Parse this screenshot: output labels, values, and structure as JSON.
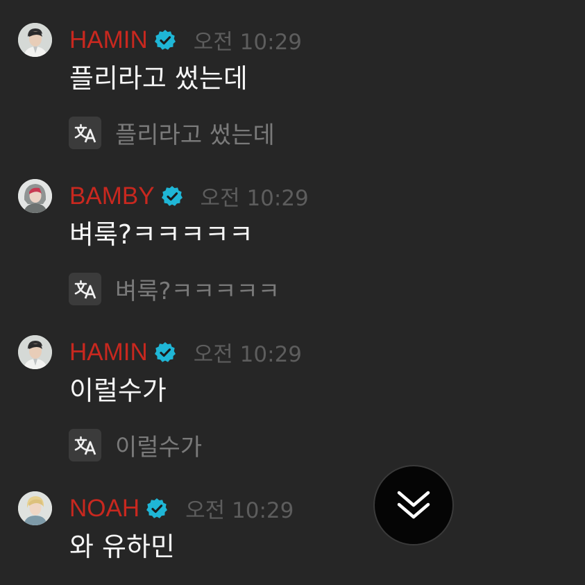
{
  "messages": [
    {
      "username": "HAMIN",
      "avatar": "hamin-avatar",
      "time": "오전 10:29",
      "text": "플리라고 썼는데",
      "translation": "플리라고 썼는데"
    },
    {
      "username": "BAMBY",
      "avatar": "bamby-avatar",
      "time": "오전 10:29",
      "text": "벼룩?ㅋㅋㅋㅋㅋ",
      "translation": "벼룩?ㅋㅋㅋㅋㅋ"
    },
    {
      "username": "HAMIN",
      "avatar": "hamin-avatar",
      "time": "오전 10:29",
      "text": "이럴수가",
      "translation": "이럴수가"
    },
    {
      "username": "NOAH",
      "avatar": "noah-avatar",
      "time": "오전 10:29",
      "text": "와 유하민"
    }
  ],
  "icons": {
    "verified": "verified-badge-icon",
    "translate": "translate-icon",
    "scroll_down": "double-chevron-down-icon"
  },
  "colors": {
    "background": "#262626",
    "username": "#c8281f",
    "verified_badge": "#1fb6d6",
    "timestamp": "#5d5d5d",
    "message_text": "#f5f5f5",
    "translated_text": "#7a7a7a"
  }
}
